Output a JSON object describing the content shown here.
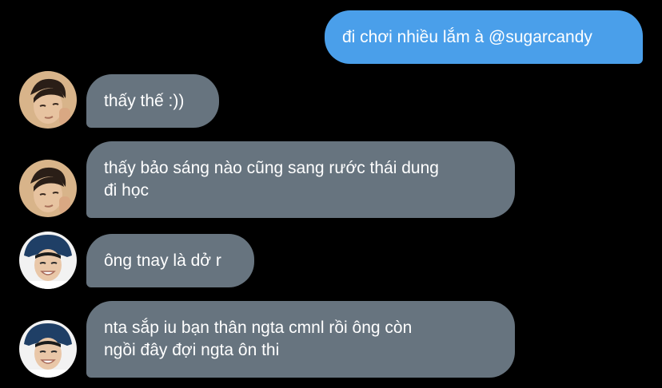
{
  "conversation": {
    "messages": [
      {
        "direction": "outgoing",
        "text": "đi chơi nhiều lắm à @sugarcandy"
      },
      {
        "direction": "incoming",
        "text": "thấy thế :))"
      },
      {
        "direction": "incoming",
        "text": "thấy bảo sáng nào cũng sang rước thái dung\nđi học"
      },
      {
        "direction": "incoming",
        "text": "ông tnay là dở r"
      },
      {
        "direction": "incoming",
        "text": "nta sắp iu bạn thân ngta cmnl rồi ông còn\nngồi đây đợi ngta ôn thi"
      }
    ],
    "colors": {
      "background": "#000000",
      "outgoing_bubble": "#4a9fea",
      "incoming_bubble": "#67747f",
      "text": "#ffffff"
    }
  }
}
